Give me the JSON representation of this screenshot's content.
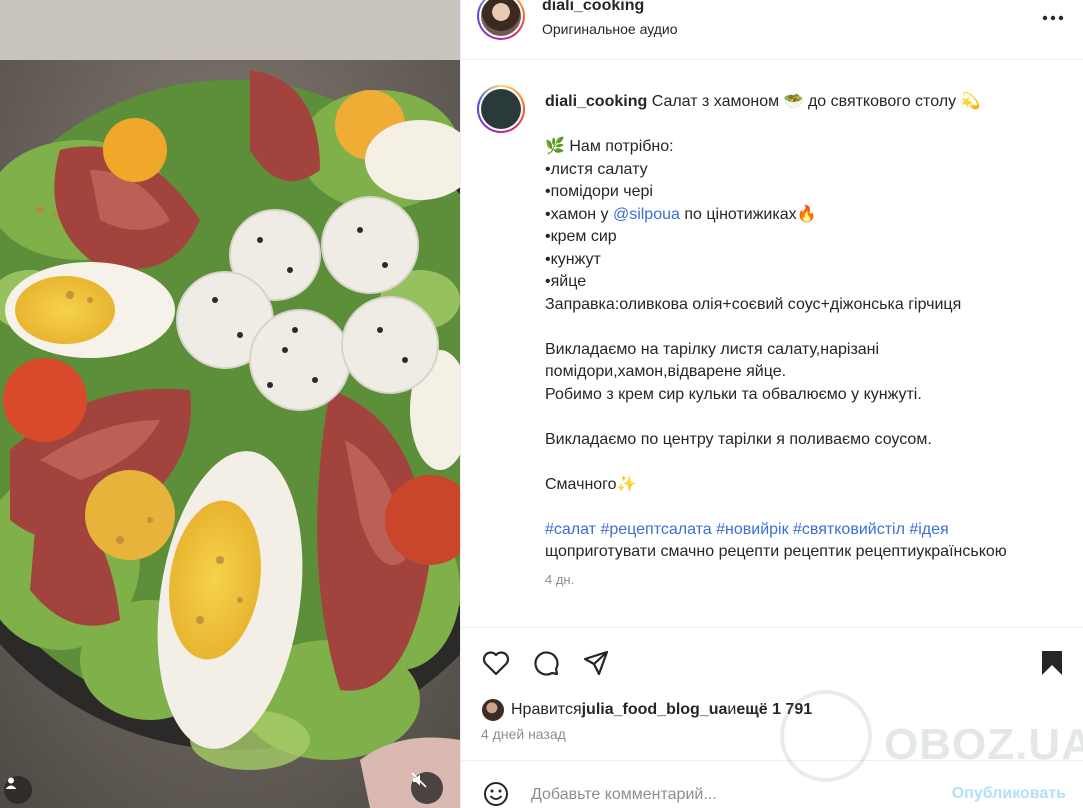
{
  "post": {
    "username": "diali_cooking",
    "audio": "Оригинальное аудио"
  },
  "caption": {
    "username": "diali_cooking",
    "title": "Салат з хамоном 🥗 до святкового столу 💫",
    "l_needed": "🌿 Нам потрібно:",
    "l1": "•листя салату",
    "l2": "•помідори черi",
    "l3_pre": "•хамон у ",
    "l3_link": "@silpoua",
    "l3_post": " по цінотижиках🔥",
    "l4": "•крем сир",
    "l5": "•кунжут",
    "l6": "•яйце",
    "l7": "Заправка:оливкова олія+соєвий соус+діжонська гірчиця",
    "p2a": "Викладаємо на тарілку листя салату,нарізані",
    "p2b": "помідори,хамон,відварене яйце.",
    "p2c": "Робимо з крем сир кульки та обвалюємо у кунжуті.",
    "p3": "Викладаємо по центру тарілки я поливаємо соусом.",
    "p4": "Смачного✨",
    "hashtags": "#салат #рецептсалата #новийрік #святковийстіл #ідея",
    "tail": "щоприготувати смачно рецепти рецептик рецептиукраїнською",
    "time": "4 дн."
  },
  "likes": {
    "prefix": "Нравится ",
    "user": "julia_food_blog_ua",
    "middle": " и ",
    "more": "ещё 1 791"
  },
  "days_ago": "4 дней назад",
  "comment": {
    "placeholder": "Добавьте комментарий...",
    "publish": "Опубликовать"
  },
  "watermark": "OBOZ.UA",
  "icons": {
    "like": "heart-icon",
    "comment": "comment-icon",
    "share": "share-icon",
    "save": "bookmark-icon",
    "more": "more-horizontal-icon",
    "emoji": "smiley-icon",
    "mute": "muted-speaker-icon",
    "user": "user-tag-icon"
  }
}
